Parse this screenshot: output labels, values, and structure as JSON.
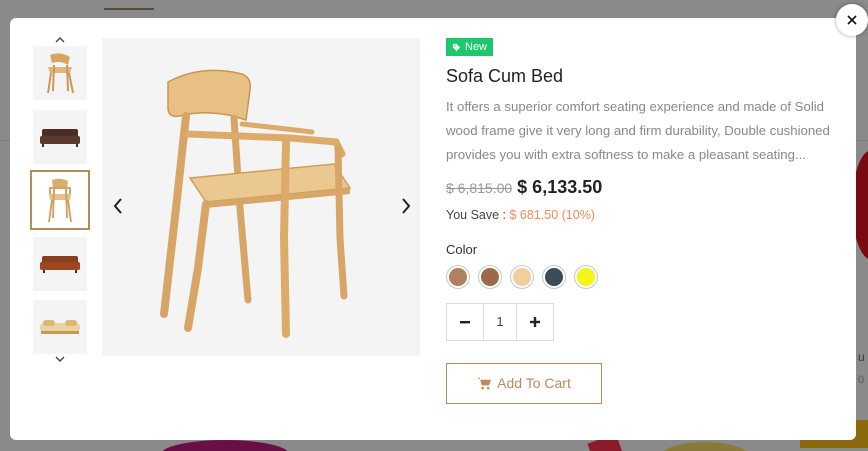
{
  "product": {
    "badge": "New",
    "title": "Sofa Cum Bed",
    "description": "It offers a superior comfort seating experience and made of Solid wood frame give it very long and firm durability, Double cushioned provides you with extra softness to make a pleasant seating...",
    "old_price": "$ 6,815.00",
    "new_price": "$ 6,133.50",
    "save_label": "You Save :",
    "save_amount": "$ 681.50 (10%)",
    "color_label": "Color",
    "colors": [
      "#b08160",
      "#9c6a48",
      "#f0cf9b",
      "#3d4a57",
      "#f5f516"
    ],
    "quantity": "1",
    "add_to_cart": "Add To Cart"
  },
  "background": {
    "partial_text_1": "u",
    "partial_text_2": "0"
  },
  "accent": "#b98a5a",
  "badge_color": "#1ec66e",
  "save_color": "#f28c58"
}
